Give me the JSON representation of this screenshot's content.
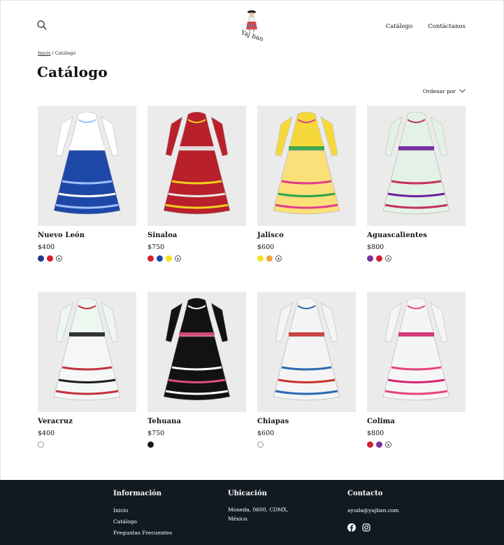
{
  "header": {
    "logo_text": "Yaj ban",
    "nav": [
      {
        "label": "Catálogo"
      },
      {
        "label": "Contáctanos"
      }
    ]
  },
  "breadcrumb": {
    "home": "Inicio",
    "separator": "/",
    "current": "Catálogo"
  },
  "page_title": "Catálogo",
  "sort": {
    "label": "Ordenar por"
  },
  "products": [
    {
      "name": "Nuevo León",
      "price": "$400",
      "swatches": [
        "#1f3a8a",
        "#d61f2c",
        "more"
      ],
      "dress": {
        "top": "#ffffff",
        "skirt": "#1e48a8",
        "accent": "#ffffff",
        "stripe": "#9ec2ff"
      }
    },
    {
      "name": "Sinaloa",
      "price": "$750",
      "swatches": [
        "#d61f2c",
        "#1e48a8",
        "#f1e31f",
        "more"
      ],
      "dress": {
        "top": "#b8202c",
        "skirt": "#b8202c",
        "accent": "#e9e9e9",
        "stripe": "#f0d21a"
      }
    },
    {
      "name": "Jalisco",
      "price": "$600",
      "swatches": [
        "#f5e21f",
        "#f2a33a",
        "more"
      ],
      "dress": {
        "top": "#f7d83b",
        "skirt": "#fbe07a",
        "accent": "#2aa44a",
        "stripe": "#e03c8c"
      }
    },
    {
      "name": "Aguascalientes",
      "price": "$800",
      "swatches": [
        "#7b2fa0",
        "#d61f2c",
        "more"
      ],
      "dress": {
        "top": "#e4f1e6",
        "skirt": "#e4f1e6",
        "accent": "#6a1f9e",
        "stripe": "#c4325a"
      }
    },
    {
      "name": "Veracruz",
      "price": "$400",
      "swatches": [
        "white"
      ],
      "dress": {
        "top": "#eef6f0",
        "skirt": "#f4f7f5",
        "accent": "#1c1c1c",
        "stripe": "#c23040"
      }
    },
    {
      "name": "Tehuana",
      "price": "$750",
      "swatches": [
        "#111a21"
      ],
      "dress": {
        "top": "#121212",
        "skirt": "#121212",
        "accent": "#e0507a",
        "stripe": "#ffffff"
      }
    },
    {
      "name": "Chiapas",
      "price": "$600",
      "swatches": [
        "white"
      ],
      "dress": {
        "top": "#f4f4f4",
        "skirt": "#f4f4f4",
        "accent": "#c8322e",
        "stripe": "#2a6ab0"
      }
    },
    {
      "name": "Colima",
      "price": "$800",
      "swatches": [
        "#d61f2c",
        "#7b2fa0",
        "more"
      ],
      "dress": {
        "top": "#f5f5f5",
        "skirt": "#f5f5f5",
        "accent": "#d6246e",
        "stripe": "#e8447e"
      }
    }
  ],
  "footer": {
    "info": {
      "title": "Información",
      "links": [
        "Inicio",
        "Catálogo",
        "Preguntas Frecuentes"
      ]
    },
    "location": {
      "title": "Ubicación",
      "lines": [
        "Moneda, 0600, CDMX,",
        "México."
      ]
    },
    "contact": {
      "title": "Contacto",
      "email": "ayuda@yajban.com",
      "social": [
        "facebook-icon",
        "instagram-icon"
      ]
    }
  },
  "colors": {
    "footer_bg": "#111a21",
    "thumb_bg": "#ebebeb"
  }
}
